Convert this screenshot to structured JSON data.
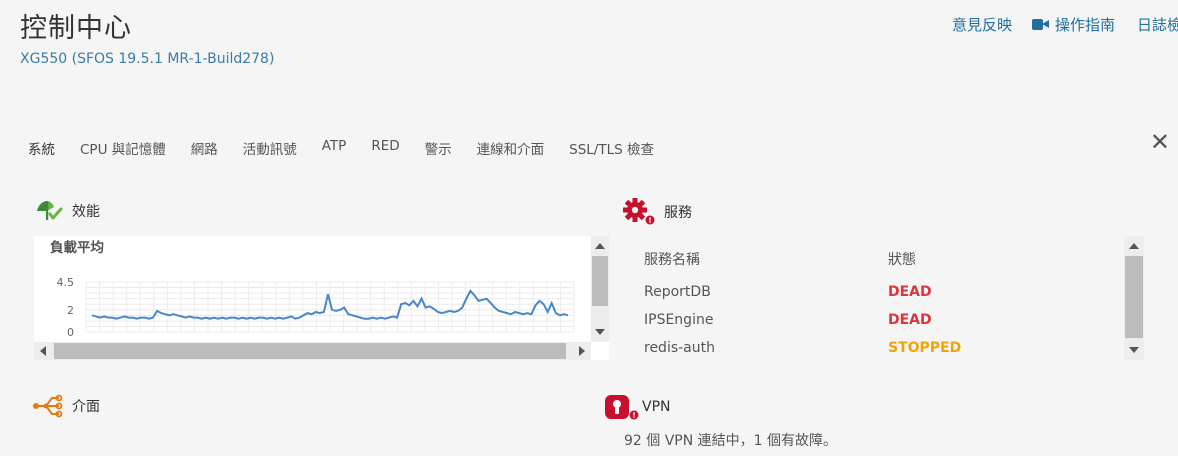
{
  "header": {
    "title": "控制中心",
    "subtitle": "XG550 (SFOS 19.5.1 MR-1-Build278)"
  },
  "top_links": {
    "feedback": "意見反映",
    "guide": "操作指南",
    "log": "日誌檢"
  },
  "tabs": [
    "系統",
    "CPU 與記憶體",
    "網路",
    "活動訊號",
    "ATP",
    "RED",
    "警示",
    "連線和介面",
    "SSL/TLS 檢查"
  ],
  "performance": {
    "title": "效能",
    "chart_label": "負載平均",
    "icon": "performance-icon"
  },
  "services": {
    "title": "服務",
    "icon": "gear-alert-icon",
    "col_name": "服務名稱",
    "col_status": "狀態",
    "rows": [
      {
        "name": "ReportDB",
        "status": "DEAD"
      },
      {
        "name": "IPSEngine",
        "status": "DEAD"
      },
      {
        "name": "redis-auth",
        "status": "STOPPED"
      }
    ]
  },
  "interfaces": {
    "title": "介面",
    "icon": "interfaces-icon"
  },
  "vpn": {
    "title": "VPN",
    "icon": "vpn-lock-alert-icon",
    "status_text": "92 個 VPN 連結中，1 個有故障。"
  },
  "colors": {
    "accent": "#1f6fa0",
    "line": "#4a86c8",
    "dead": "#d9363e",
    "stopped": "#f0a30a"
  },
  "chart_data": {
    "type": "line",
    "title": "負載平均",
    "ylim": [
      0,
      4.5
    ],
    "yticks": [
      0,
      2,
      4.5
    ],
    "series": [
      {
        "values": [
          1.5,
          1.4,
          1.3,
          1.4,
          1.3,
          1.3,
          1.2,
          1.3,
          1.4,
          1.3,
          1.3,
          1.2,
          1.3,
          1.3,
          1.2,
          1.3,
          1.9,
          1.7,
          1.6,
          1.5,
          1.6,
          1.5,
          1.4,
          1.3,
          1.4,
          1.3,
          1.3,
          1.2,
          1.3,
          1.2,
          1.3,
          1.2,
          1.3,
          1.2,
          1.3,
          1.3,
          1.2,
          1.3,
          1.2,
          1.3,
          1.2,
          1.3,
          1.3,
          1.2,
          1.3,
          1.2,
          1.3,
          1.2,
          1.3,
          1.4,
          1.2,
          1.3,
          1.5,
          1.7,
          1.6,
          1.8,
          1.7,
          1.8,
          3.4,
          2.0,
          1.9,
          2.0,
          2.2,
          1.6,
          1.5,
          1.4,
          1.3,
          1.2,
          1.2,
          1.3,
          1.2,
          1.3,
          1.2,
          1.3,
          1.4,
          1.3,
          2.5,
          2.6,
          2.4,
          2.8,
          2.3,
          3.0,
          2.2,
          2.3,
          2.1,
          1.8,
          1.7,
          1.8,
          1.9,
          1.8,
          1.9,
          2.2,
          3.0,
          3.7,
          3.3,
          2.8,
          2.9,
          3.0,
          2.6,
          2.2,
          1.9,
          1.8,
          1.7,
          1.6,
          1.8,
          1.7,
          1.6,
          1.7,
          1.6,
          2.4,
          2.8,
          2.5,
          1.8,
          2.6,
          1.7,
          1.5,
          1.6,
          1.5
        ]
      }
    ]
  }
}
